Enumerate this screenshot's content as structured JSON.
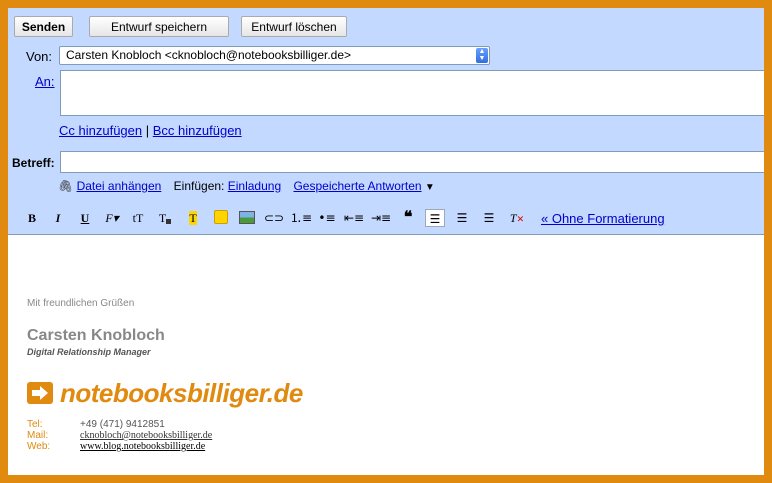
{
  "actions": {
    "send": "Senden",
    "save_draft": "Entwurf speichern",
    "delete_draft": "Entwurf löschen"
  },
  "from": {
    "label": "Von:",
    "value": "Carsten Knobloch <cknobloch@notebooksbilliger.de>"
  },
  "to": {
    "label": "An:",
    "value": ""
  },
  "cc_bcc": {
    "cc": "Cc hinzufügen",
    "separator": "|",
    "bcc": "Bcc hinzufügen"
  },
  "subject": {
    "label": "Betreff:",
    "value": ""
  },
  "attach": {
    "attach_label": "Datei anhängen",
    "insert_label": "Einfügen:",
    "invitation": "Einladung",
    "saved_replies": "Gespeicherte Antworten",
    "dropdown_arrow": "▼"
  },
  "formatting": {
    "bold": "B",
    "italic": "I",
    "underline": "U",
    "font": "F",
    "size": "tT",
    "text_color": "T",
    "highlight": "T",
    "plain_text": "« Ohne Formatierung"
  },
  "signature": {
    "greeting": "Mit freundlichen Grüßen",
    "name": "Carsten Knobloch",
    "title": "Digital Relationship Manager",
    "brand": "notebooksbilliger.de",
    "contacts": [
      {
        "key": "Tel:",
        "value": "+49 (471) 9412851"
      },
      {
        "key": "Mail:",
        "value": "cknobloch@notebooksbilliger.de"
      },
      {
        "key": "Web:",
        "value": "www.blog.notebooksbilliger.de"
      }
    ]
  },
  "colors": {
    "accent": "#e08a10",
    "panel": "#c3d9ff",
    "link": "#0000cc"
  }
}
